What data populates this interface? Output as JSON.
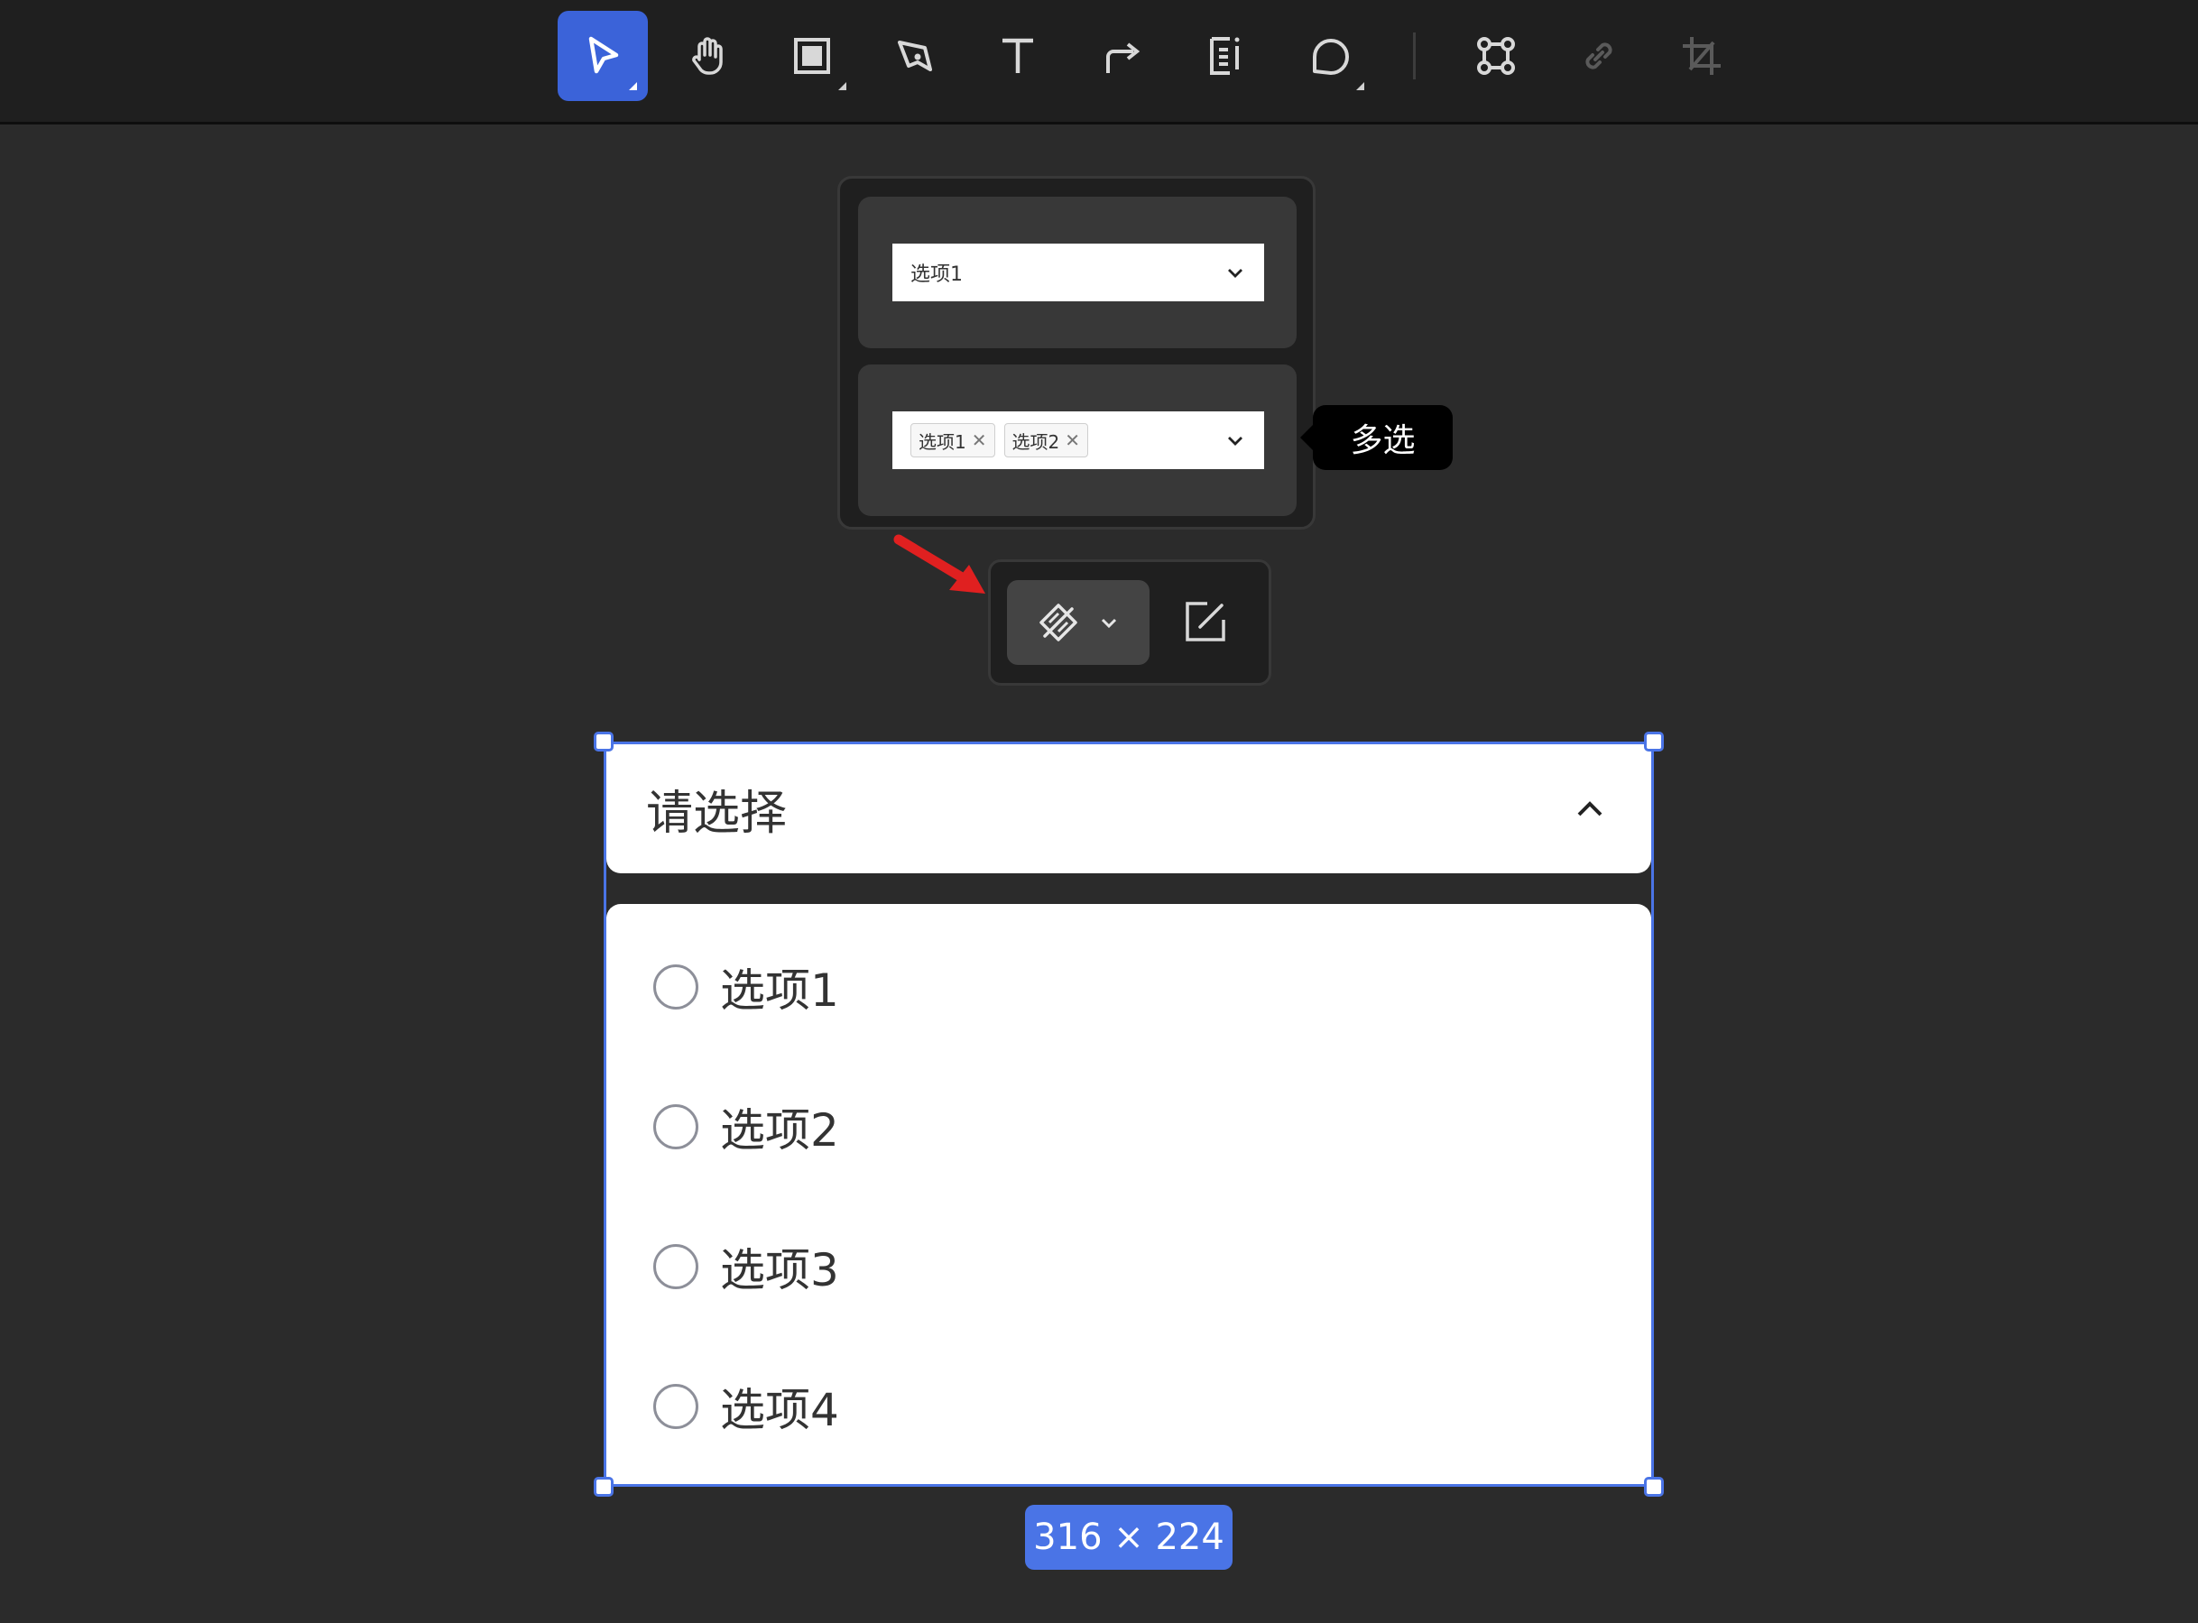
{
  "toolbar": {
    "tools": [
      {
        "icon": "cursor-icon",
        "active": true
      },
      {
        "icon": "hand-icon"
      },
      {
        "icon": "frame-icon"
      },
      {
        "icon": "pen-icon"
      },
      {
        "icon": "text-icon"
      },
      {
        "icon": "connector-icon"
      },
      {
        "icon": "list-text-icon"
      },
      {
        "icon": "comment-icon"
      },
      {
        "icon": "component-icon"
      },
      {
        "icon": "link-icon",
        "disabled": true
      },
      {
        "icon": "crop-icon",
        "disabled": true
      }
    ]
  },
  "variants": {
    "single": {
      "value": "选项1"
    },
    "multi": {
      "tags": [
        "选项1",
        "选项2"
      ],
      "tag_remove_glyph": "✕"
    }
  },
  "tooltip": {
    "text": "多选"
  },
  "floating_toolbar": {
    "icons": [
      "component-variant-icon",
      "chevron-down-icon",
      "edit-icon"
    ]
  },
  "select": {
    "placeholder": "请选择",
    "options": [
      {
        "label": "选项1"
      },
      {
        "label": "选项2"
      },
      {
        "label": "选项3"
      },
      {
        "label": "选项4"
      }
    ]
  },
  "selection": {
    "dimensions": "316 × 224"
  },
  "colors": {
    "accent": "#3b63d9",
    "selection": "#4a74e6",
    "canvas": "#2b2b2b",
    "toolbar": "#1f1f1f",
    "annotation_arrow": "#e02020"
  }
}
